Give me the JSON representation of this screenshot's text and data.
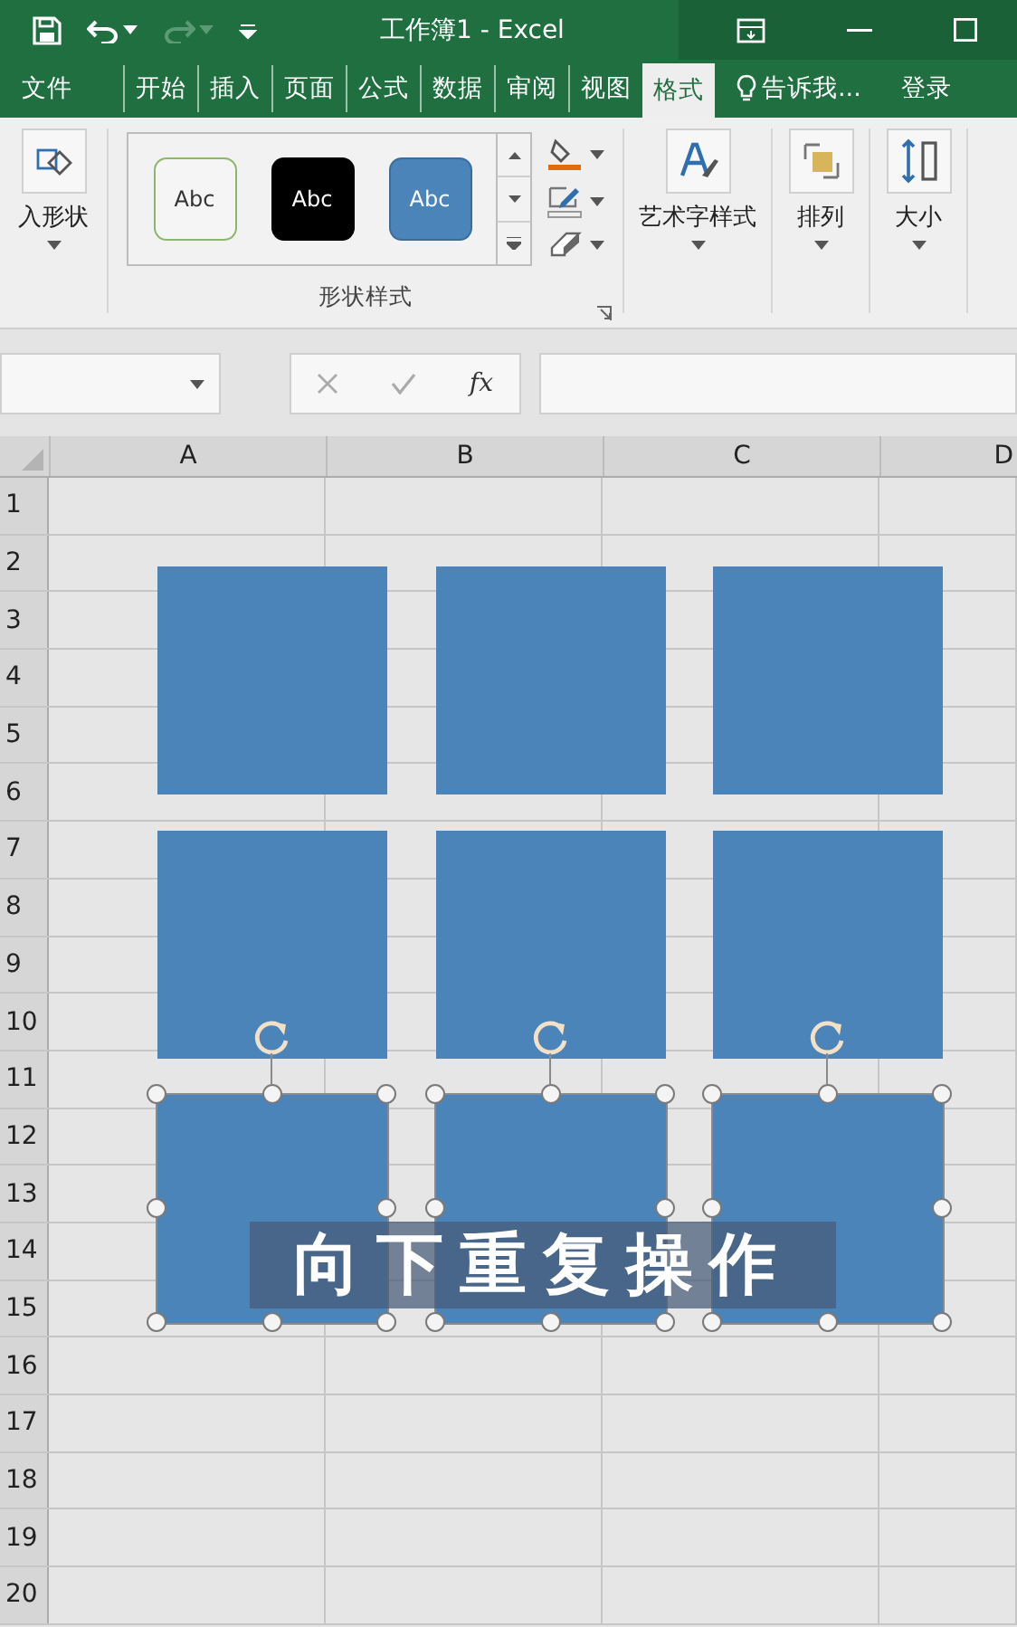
{
  "window": {
    "title": "工作簿1 - Excel"
  },
  "quick_access": [
    {
      "kind": "save",
      "disabled": false
    },
    {
      "kind": "undo",
      "disabled": false
    },
    {
      "kind": "redo",
      "disabled": true
    }
  ],
  "tabs": [
    {
      "label": "文件",
      "selected": false
    },
    {
      "label": "开始",
      "selected": false
    },
    {
      "label": "插入",
      "selected": false
    },
    {
      "label": "页面",
      "selected": false
    },
    {
      "label": "公式",
      "selected": false
    },
    {
      "label": "数据",
      "selected": false
    },
    {
      "label": "审阅",
      "selected": false
    },
    {
      "label": "视图",
      "selected": false
    },
    {
      "label": "格式",
      "selected": true
    }
  ],
  "tell_me": "告诉我...",
  "sign_in": "登录",
  "ribbon": {
    "insert_shapes": "入形状",
    "shape_styles": {
      "label": "形状样式",
      "swatches": [
        {
          "text": "Abc",
          "kind": "outline"
        },
        {
          "text": "Abc",
          "kind": "dark"
        },
        {
          "text": "Abc",
          "kind": "filled"
        }
      ]
    },
    "commands": [
      {
        "label": "艺术字样式",
        "kind": "wordart"
      },
      {
        "label": "排列",
        "kind": "arrange"
      },
      {
        "label": "大小",
        "kind": "size"
      }
    ]
  },
  "formula_bar": {
    "function_label": "fx"
  },
  "sheet": {
    "columns": [
      "A",
      "B",
      "C",
      "D"
    ],
    "rows": [
      "1",
      "2",
      "3",
      "4",
      "5",
      "6",
      "7",
      "8",
      "9",
      "10",
      "11",
      "12",
      "13",
      "14",
      "15",
      "16",
      "17",
      "18",
      "19",
      "20"
    ],
    "shapes": [
      {
        "selected": false
      },
      {
        "selected": false
      },
      {
        "selected": false
      },
      {
        "selected": false
      },
      {
        "selected": false
      },
      {
        "selected": false
      },
      {
        "selected": true
      },
      {
        "selected": true
      },
      {
        "selected": true
      }
    ]
  },
  "caption": "向下重复操作"
}
